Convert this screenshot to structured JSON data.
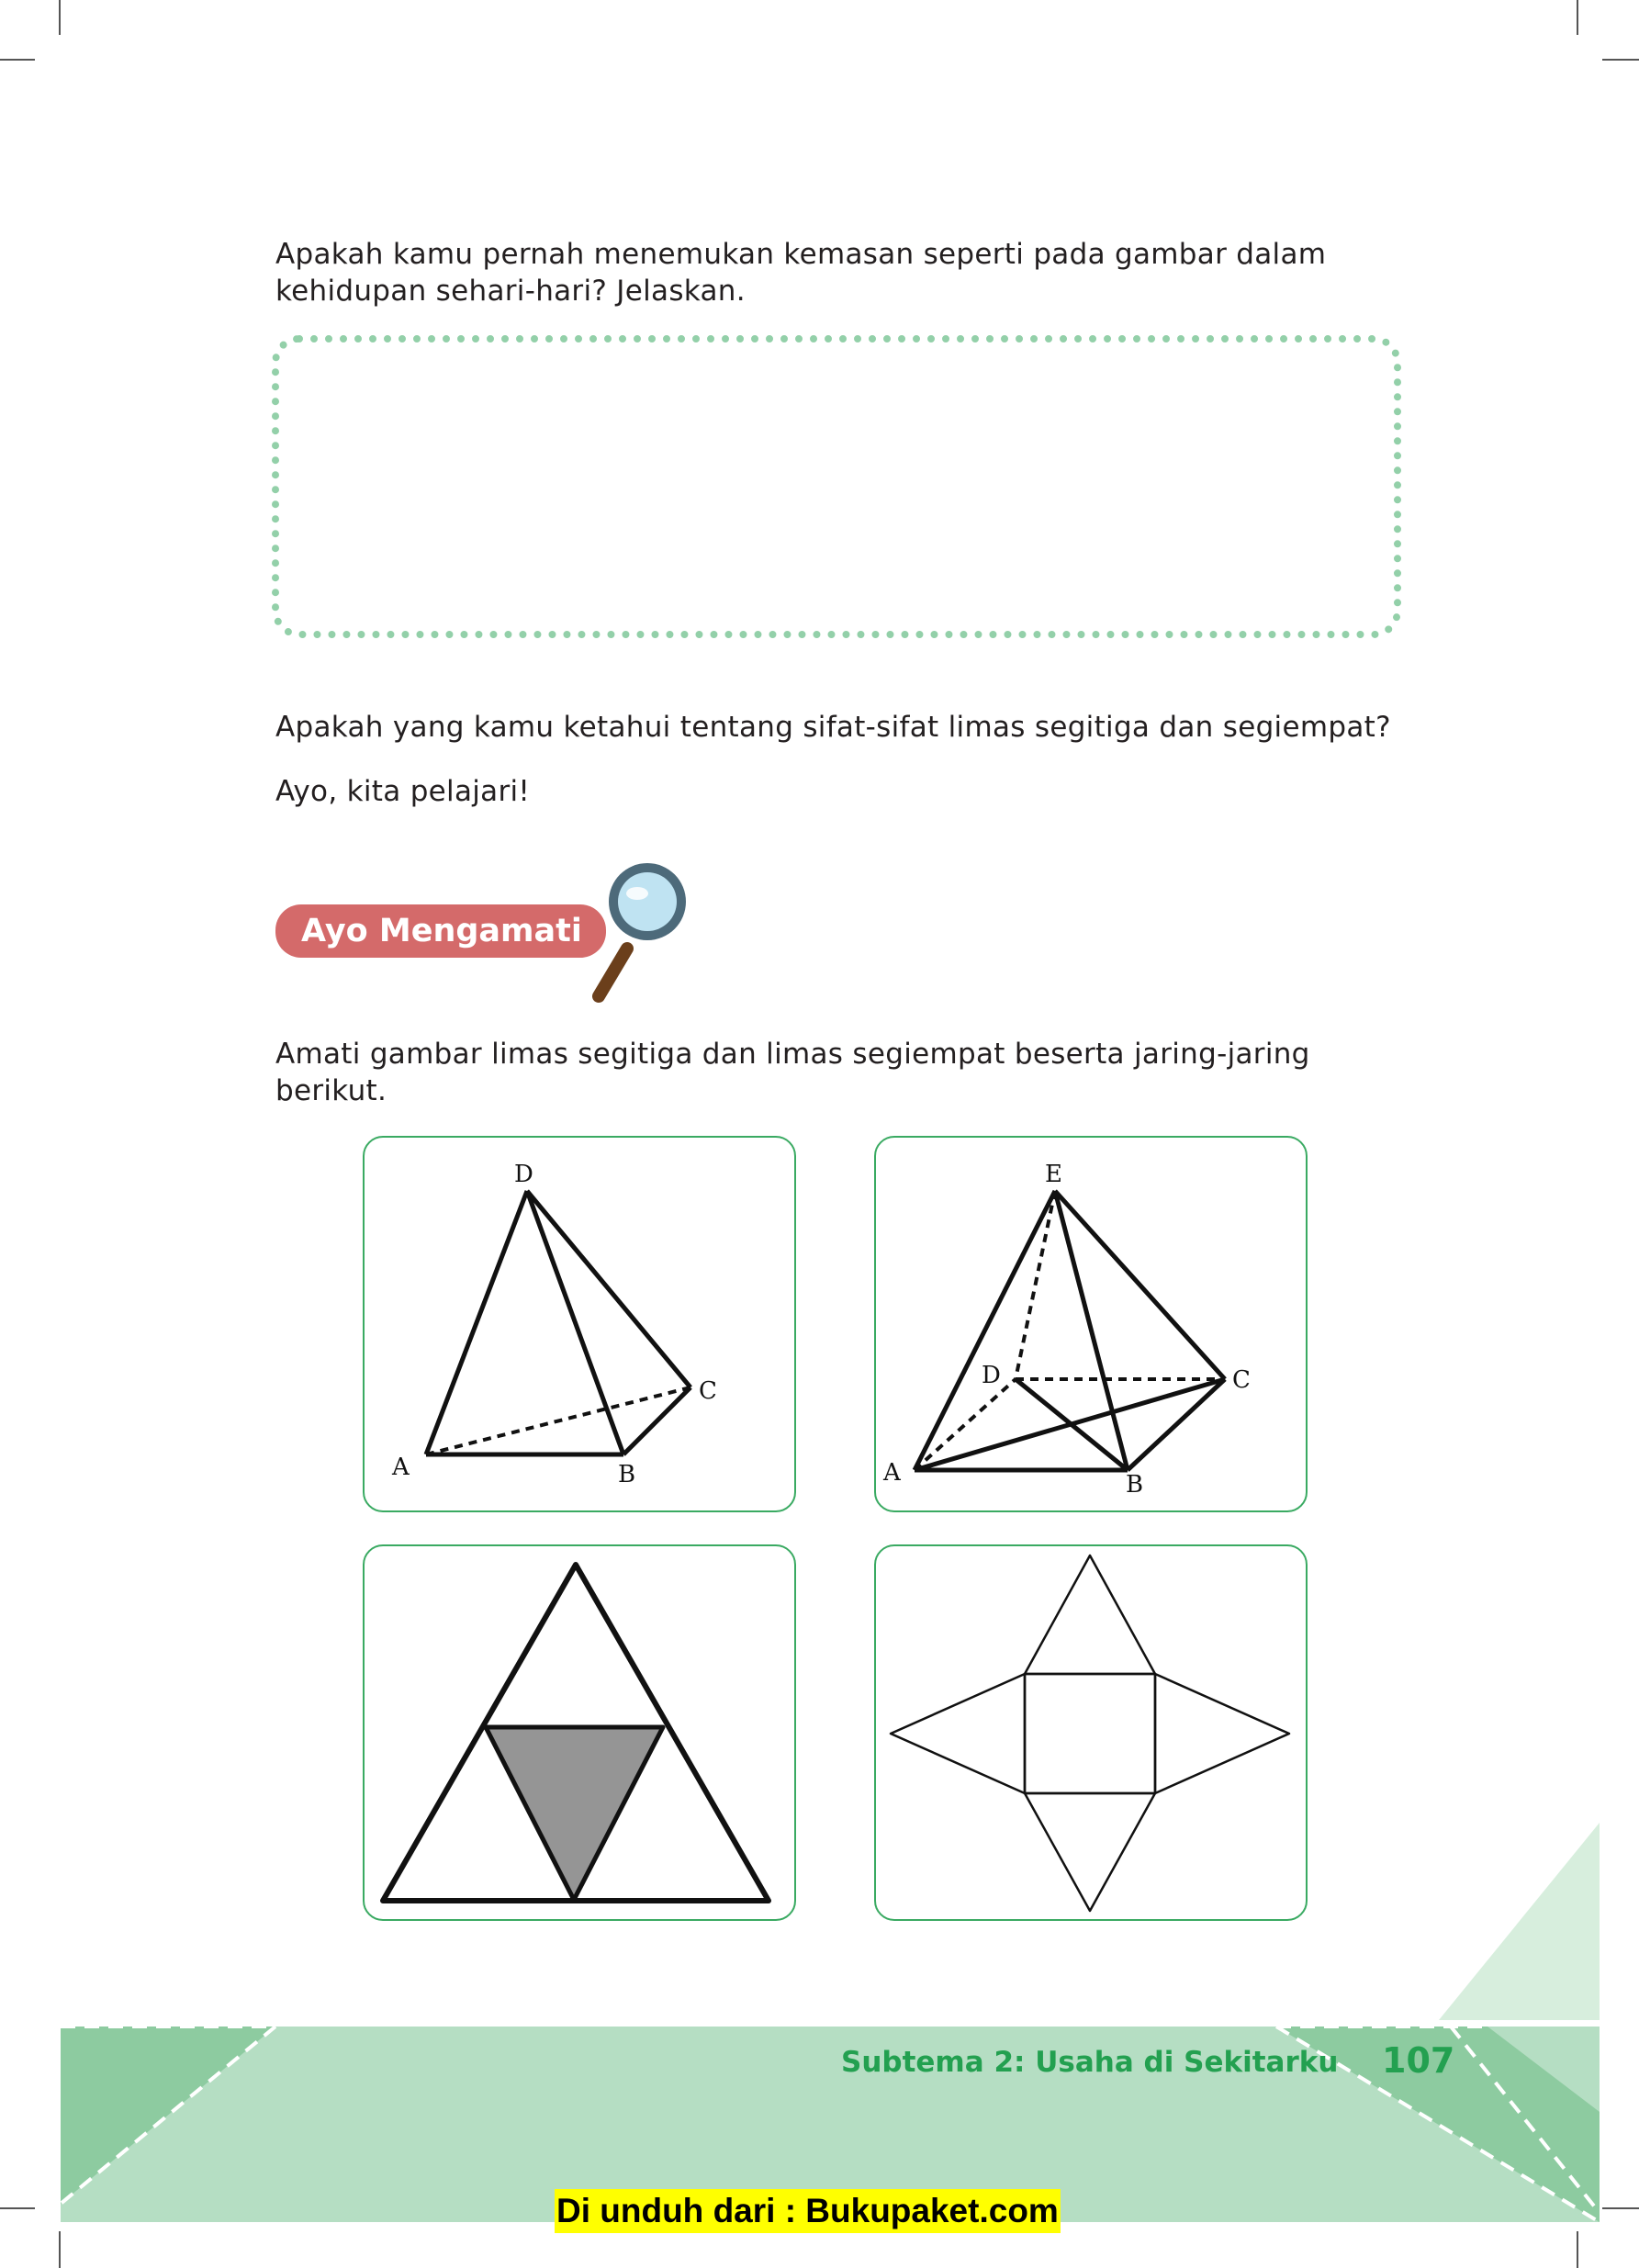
{
  "intro": {
    "question_1": "Apakah kamu pernah menemukan kemasan seperti pada gambar dalam kehidupan sehari-hari? Jelaskan.",
    "question_2": "Apakah yang kamu ketahui tentang sifat-sifat limas segitiga dan segiempat?",
    "prompt": "Ayo, kita pelajari!"
  },
  "section": {
    "title": "Ayo Mengamati",
    "icon": "magnifier-icon",
    "accent_color": "#d46a6a"
  },
  "observe_text": "Amati gambar limas segitiga dan limas segiempat beserta jaring-jaring berikut.",
  "figures": {
    "triangular_pyramid": {
      "labels": [
        "D",
        "C",
        "A",
        "B"
      ]
    },
    "square_pyramid": {
      "labels": [
        "E",
        "D",
        "C",
        "A",
        "B"
      ]
    },
    "triangular_net": {
      "shaded_color": "#959595"
    },
    "square_net": {}
  },
  "footer": {
    "subtheme": "Subtema 2: Usaha di Sekitarku",
    "page_number": "107",
    "band_color": "#b5dec3",
    "text_color": "#23a050"
  },
  "download_notice": "Di unduh dari : Bukupaket.com"
}
